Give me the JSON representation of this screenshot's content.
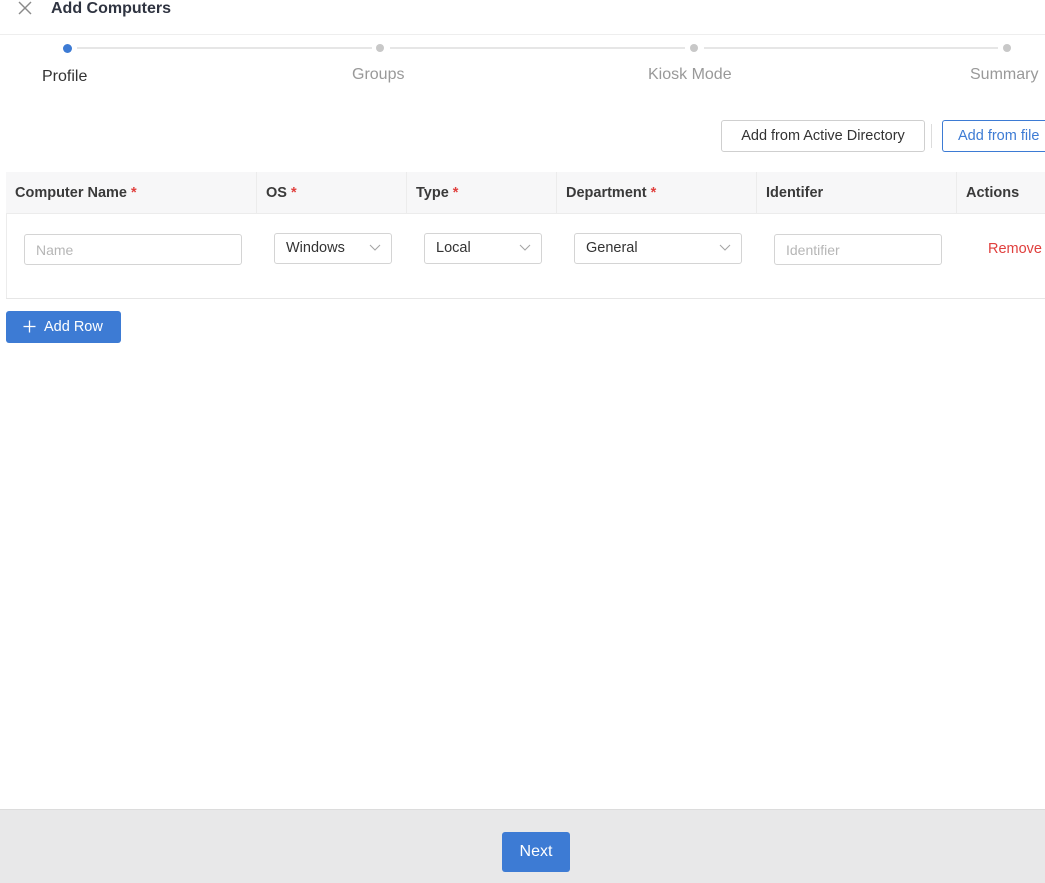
{
  "header": {
    "title": "Add Computers",
    "close_icon": "close-icon"
  },
  "stepper": {
    "steps": [
      {
        "label": "Profile",
        "state": "active"
      },
      {
        "label": "Groups",
        "state": "pending"
      },
      {
        "label": "Kiosk Mode",
        "state": "pending"
      },
      {
        "label": "Summary",
        "state": "pending"
      }
    ]
  },
  "actions": {
    "add_from_ad_label": "Add from Active Directory",
    "add_from_file_label": "Add from file"
  },
  "table": {
    "columns": [
      {
        "label": "Computer Name",
        "required": "*"
      },
      {
        "label": "OS",
        "required": "*"
      },
      {
        "label": "Type",
        "required": "*"
      },
      {
        "label": "Department",
        "required": "*"
      },
      {
        "label": "Identifer",
        "required": ""
      },
      {
        "label": "Actions",
        "required": ""
      }
    ],
    "rows": [
      {
        "name_value": "",
        "name_placeholder": "Name",
        "os": "Windows",
        "type": "Local",
        "department": "General",
        "identifier_value": "",
        "identifier_placeholder": "Identifier",
        "remove_label": "Remove"
      }
    ]
  },
  "add_row_label": "Add Row",
  "footer": {
    "next_label": "Next"
  },
  "colors": {
    "accent": "#3d7bd4",
    "danger": "#e0403e",
    "footer_bg": "#e8e8e9"
  }
}
